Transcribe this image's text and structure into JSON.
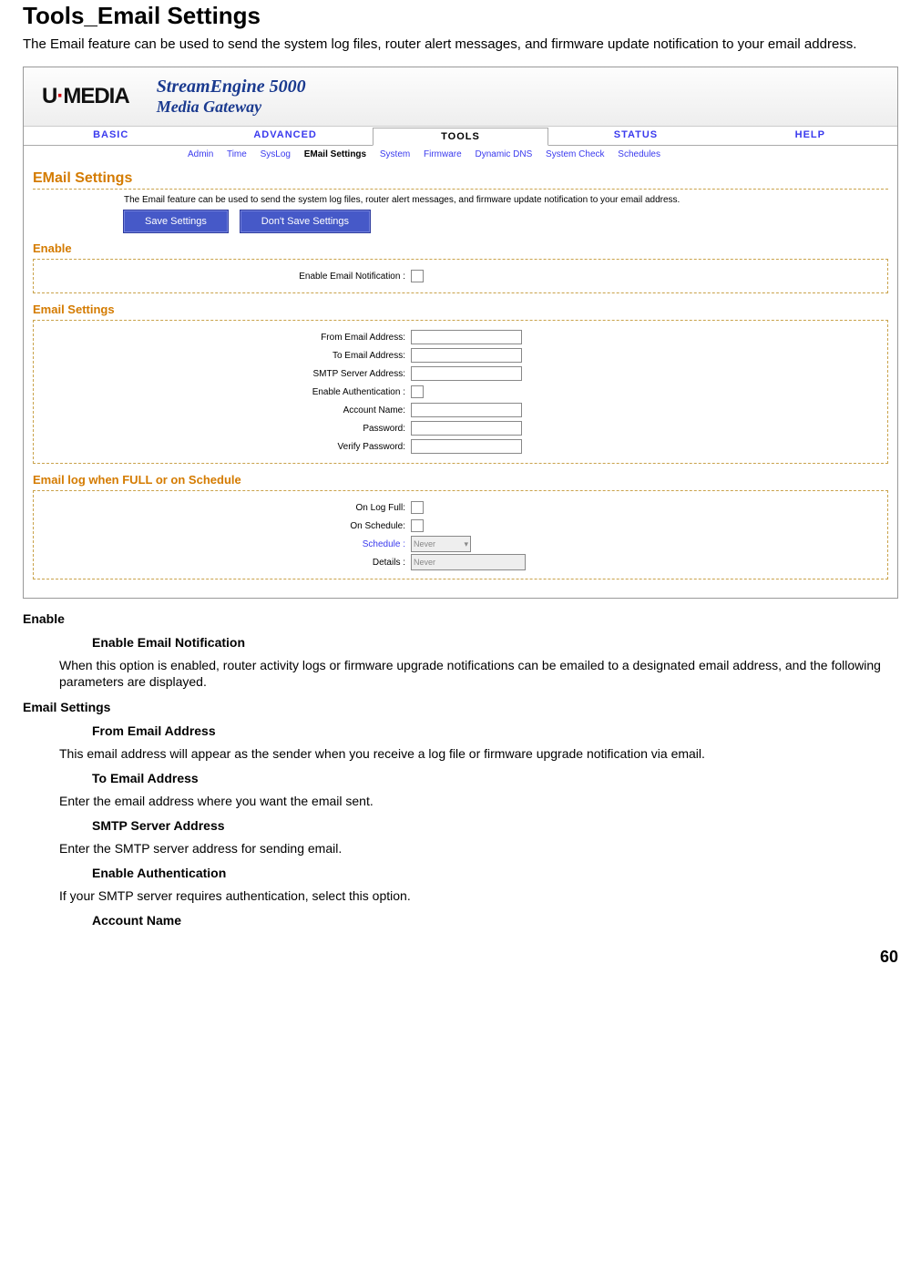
{
  "doc": {
    "title": "Tools_Email Settings",
    "intro": "The Email feature can be used to send the system log files, router alert messages, and firmware update notification to your email address.",
    "page_number": "60"
  },
  "router": {
    "logo": {
      "u": "U",
      "dash": "·",
      "media": "MEDIA"
    },
    "brand": {
      "line1": "StreamEngine 5000",
      "line2": "Media Gateway"
    },
    "main_nav": [
      "BASIC",
      "ADVANCED",
      "TOOLS",
      "STATUS",
      "HELP"
    ],
    "sub_nav": [
      "Admin",
      "Time",
      "SysLog",
      "EMail Settings",
      "System",
      "Firmware",
      "Dynamic DNS",
      "System Check",
      "Schedules"
    ],
    "page_title": "EMail Settings",
    "intro_text": "The Email feature can be used to send the system log files, router alert messages, and firmware update notification to your email address.",
    "buttons": {
      "save": "Save Settings",
      "dont": "Don't Save Settings"
    },
    "sections": {
      "enable": {
        "title": "Enable",
        "fields": {
          "enable_notif": "Enable Email Notification :"
        }
      },
      "email": {
        "title": "Email Settings",
        "fields": {
          "from": "From Email Address:",
          "to": "To Email Address:",
          "smtp": "SMTP Server Address:",
          "auth": "Enable Authentication :",
          "account": "Account Name:",
          "password": "Password:",
          "verify": "Verify Password:"
        }
      },
      "log": {
        "title": "Email log when FULL or on Schedule",
        "fields": {
          "onfull": "On Log Full:",
          "onsched": "On Schedule:",
          "schedule": "Schedule :",
          "details": "Details :"
        },
        "values": {
          "schedule_val": "Never",
          "details_val": "Never"
        }
      }
    }
  },
  "help": {
    "enable_h": "Enable",
    "enable_notif_h": "Enable Email Notification",
    "enable_notif_p": "When this option is enabled, router activity logs or firmware upgrade notifications can be emailed to a designated email address, and the following parameters are displayed.",
    "email_h": "Email Settings",
    "from_h": "From Email Address",
    "from_p": "This email address will appear as the sender when you receive a log file or firmware upgrade notification via email.",
    "to_h": "To Email Address",
    "to_p": "Enter the email address where you want the email sent.",
    "smtp_h": "SMTP Server Address",
    "smtp_p": "Enter the SMTP server address for sending email.",
    "auth_h": "Enable Authentication",
    "auth_p": "If your SMTP server requires authentication, select this option.",
    "account_h": "Account Name"
  }
}
